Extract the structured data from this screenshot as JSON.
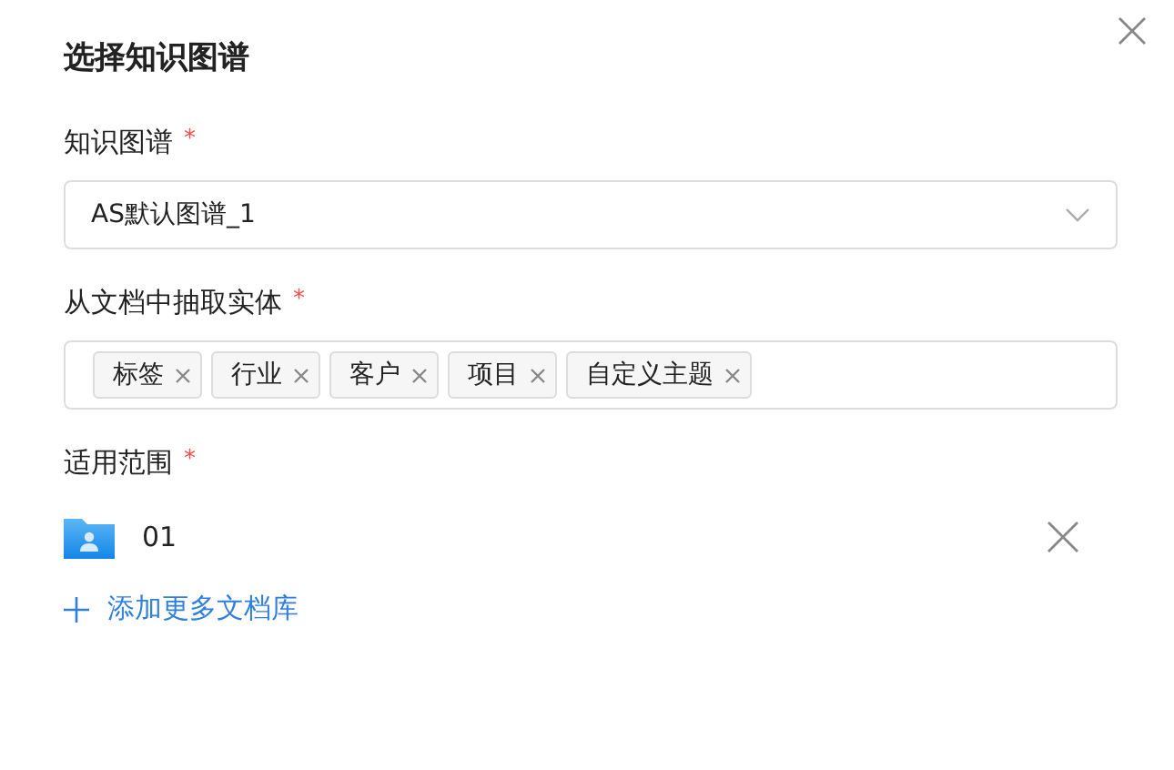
{
  "dialog": {
    "title": "选择知识图谱"
  },
  "fields": [
    {
      "kind": "select",
      "label": "知识图谱",
      "required_mark": "*",
      "value": "AS默认图谱_1"
    },
    {
      "kind": "tags",
      "label": "从文档中抽取实体",
      "required_mark": "*",
      "tags": [
        "标签",
        "行业",
        "客户",
        "项目",
        "自定义主题"
      ]
    },
    {
      "kind": "libraries",
      "label": "适用范围",
      "required_mark": "*",
      "items": [
        {
          "name": "01"
        }
      ],
      "add_link": "添加更多文档库"
    }
  ]
}
